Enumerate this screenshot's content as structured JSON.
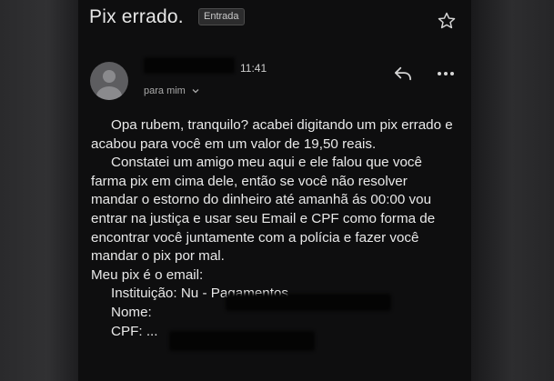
{
  "email": {
    "subject": "Pix errado.",
    "label_badge": "Entrada",
    "time": "11:41",
    "recipient": "para mim",
    "body": {
      "p1": "Opa rubem, tranquilo? acabei digitando um pix errado e acabou para você em um valor de 19,50 reais.",
      "p2": "Constatei um amigo meu aqui e ele falou que você farma pix em cima dele, então se você não resolver mandar o estorno do dinheiro até amanhã ás 00:00 vou entrar na justiça e usar seu Email e CPF como forma de encontrar você juntamente com a polícia e fazer você mandar o pix por mal.",
      "pix_line": "Meu pix é o email:",
      "institution": "Instituição: Nu - Pagamentos",
      "name_label": "Nome:",
      "cpf": "CPF: ..."
    }
  },
  "icons": {
    "star": "star-icon",
    "reply": "reply-icon",
    "more": "more-vert-icon",
    "avatar": "person-avatar-icon",
    "dropdown": "chevron-down-icon"
  },
  "colors": {
    "background": "#0e0e0f",
    "text": "#e9e9e9",
    "muted": "#a9a9a9"
  }
}
